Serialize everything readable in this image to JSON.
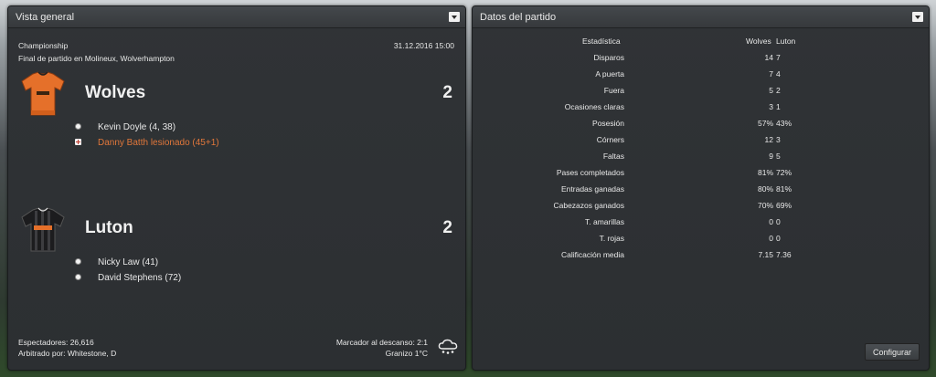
{
  "overview": {
    "title": "Vista general",
    "competition": "Championship",
    "date": "31.12.2016 15:00",
    "subtitle": "Final de partido en Molineux, Wolverhampton",
    "home": {
      "name": "Wolves",
      "score": "2",
      "events": [
        {
          "type": "goal",
          "text": "Kevin Doyle (4, 38)"
        },
        {
          "type": "injury",
          "text": "Danny Batth lesionado (45+1)"
        }
      ]
    },
    "away": {
      "name": "Luton",
      "score": "2",
      "events": [
        {
          "type": "goal",
          "text": "Nicky Law (41)"
        },
        {
          "type": "goal",
          "text": "David Stephens (72)"
        }
      ]
    },
    "attendance": "Espectadores: 26,616",
    "referee": "Arbitrado por: Whitestone, D",
    "halftime": "Marcador al descanso: 2:1",
    "weather": "Granizo 1°C",
    "weather_icon": "hail-cloud-icon"
  },
  "stats": {
    "title": "Datos del partido",
    "col_label": "Estadística",
    "col_home": "Wolves",
    "col_away": "Luton",
    "rows": [
      {
        "label": "Disparos",
        "home": "14",
        "away": "7"
      },
      {
        "label": "A puerta",
        "home": "7",
        "away": "4"
      },
      {
        "label": "Fuera",
        "home": "5",
        "away": "2"
      },
      {
        "label": "Ocasiones claras",
        "home": "3",
        "away": "1"
      },
      {
        "label": "Posesión",
        "home": "57%",
        "away": "43%"
      },
      {
        "label": "Córners",
        "home": "12",
        "away": "3"
      },
      {
        "label": "Faltas",
        "home": "9",
        "away": "5"
      },
      {
        "label": "Pases completados",
        "home": "81%",
        "away": "72%"
      },
      {
        "label": "Entradas ganadas",
        "home": "80%",
        "away": "81%"
      },
      {
        "label": "Cabezazos ganados",
        "home": "70%",
        "away": "69%"
      },
      {
        "label": "T. amarillas",
        "home": "0",
        "away": "0"
      },
      {
        "label": "T. rojas",
        "home": "0",
        "away": "0"
      },
      {
        "label": "Calificación media",
        "home": "7.15",
        "away": "7.36"
      }
    ],
    "configure_label": "Configurar"
  },
  "colors": {
    "injury_text": "#e0773a",
    "home_kit": "#e5702a",
    "away_kit": "#1c1c1e"
  }
}
